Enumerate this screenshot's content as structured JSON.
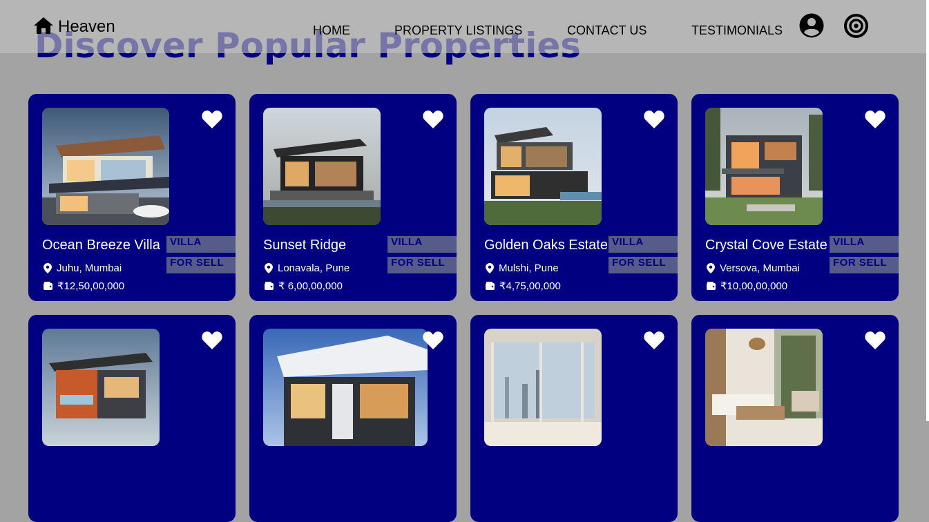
{
  "brand": {
    "name": "Heaven",
    "icon": "home-icon"
  },
  "nav": {
    "links": [
      "HOME",
      "PROPERTY LISTINGS",
      "CONTACT US",
      "TESTIMONIALS"
    ],
    "icons": [
      "account-icon",
      "target-icon"
    ]
  },
  "heading": "Discover Popular Properties",
  "colors": {
    "accent": "#000080",
    "tag_bg": "#565b8a",
    "page_bg": "#a3a3a3"
  },
  "properties": [
    {
      "title": "Ocean Breeze Villa",
      "type": "VILLA",
      "status": "FOR SELL",
      "location": "Juhu, Mumbai",
      "price": "₹12,50,00,000"
    },
    {
      "title": "Sunset Ridge",
      "type": "VILLA",
      "status": "FOR SELL",
      "location": "Lonavala, Pune",
      "price": "₹ 6,00,00,000"
    },
    {
      "title": "Golden Oaks Estate",
      "type": "VILLA",
      "status": "FOR SELL",
      "location": "Mulshi, Pune",
      "price": "₹4,75,00,000"
    },
    {
      "title": "Crystal Cove Estate",
      "type": "VILLA",
      "status": "FOR SELL",
      "location": "Versova, Mumbai",
      "price": "₹10,00,00,000"
    }
  ]
}
